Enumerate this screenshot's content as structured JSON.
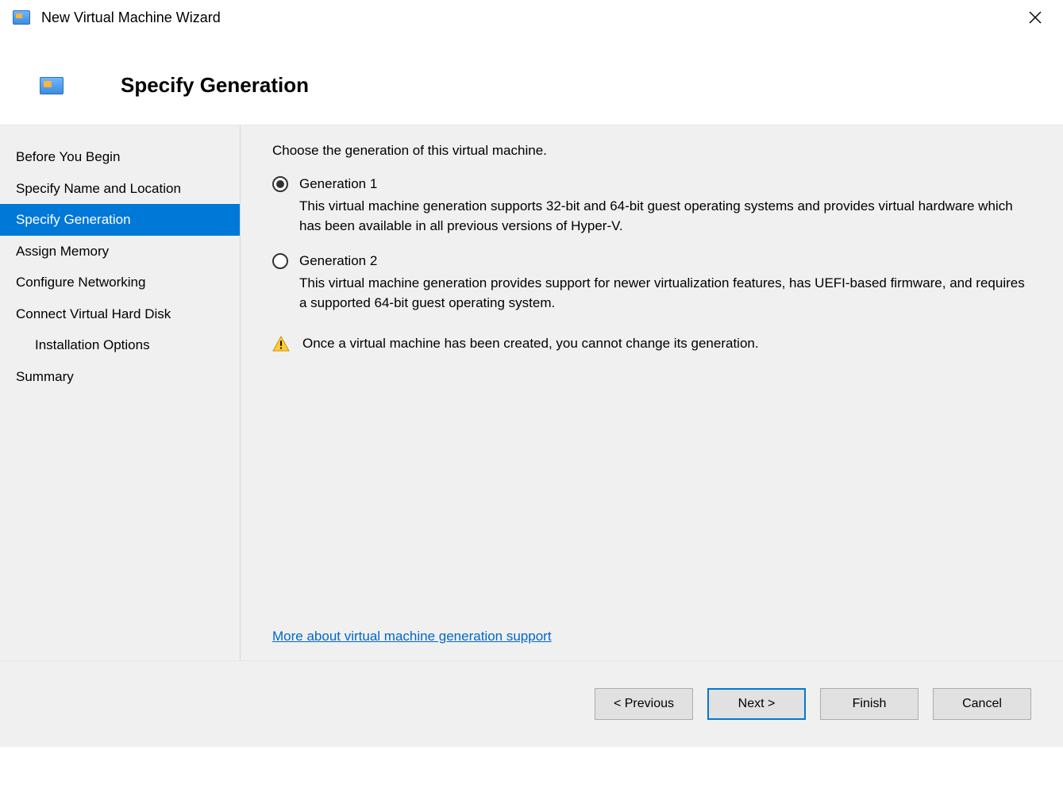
{
  "window": {
    "title": "New Virtual Machine Wizard"
  },
  "header": {
    "page_title": "Specify Generation"
  },
  "sidebar": {
    "items": [
      {
        "label": "Before You Begin",
        "indent": false,
        "active": false
      },
      {
        "label": "Specify Name and Location",
        "indent": false,
        "active": false
      },
      {
        "label": "Specify Generation",
        "indent": false,
        "active": true
      },
      {
        "label": "Assign Memory",
        "indent": false,
        "active": false
      },
      {
        "label": "Configure Networking",
        "indent": false,
        "active": false
      },
      {
        "label": "Connect Virtual Hard Disk",
        "indent": false,
        "active": false
      },
      {
        "label": "Installation Options",
        "indent": true,
        "active": false
      },
      {
        "label": "Summary",
        "indent": false,
        "active": false
      }
    ]
  },
  "content": {
    "intro": "Choose the generation of this virtual machine.",
    "options": [
      {
        "label": "Generation 1",
        "checked": true,
        "description": "This virtual machine generation supports 32-bit and 64-bit guest operating systems and provides virtual hardware which has been available in all previous versions of Hyper-V."
      },
      {
        "label": "Generation 2",
        "checked": false,
        "description": "This virtual machine generation provides support for newer virtualization features, has UEFI-based firmware, and requires a supported 64-bit guest operating system."
      }
    ],
    "warning": "Once a virtual machine has been created, you cannot change its generation.",
    "learn_more": "More about virtual machine generation support"
  },
  "footer": {
    "previous": "< Previous",
    "next": "Next >",
    "finish": "Finish",
    "cancel": "Cancel"
  }
}
